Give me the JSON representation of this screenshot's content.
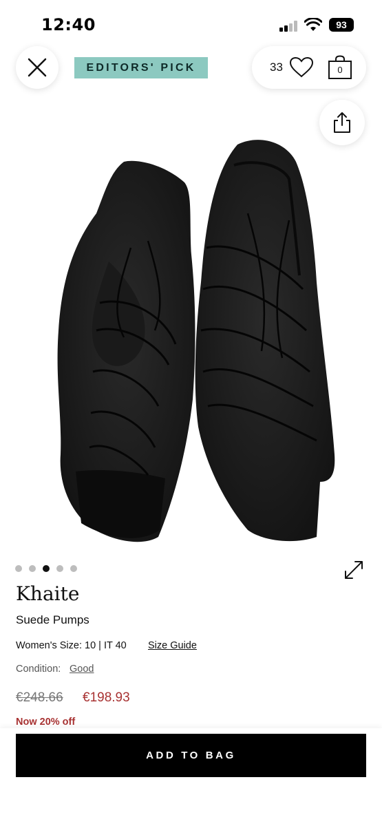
{
  "status": {
    "time": "12:40",
    "battery": "93"
  },
  "header": {
    "badge": "EDITORS' PICK",
    "like_count": "33",
    "bag_count": "0"
  },
  "carousel": {
    "total": 5,
    "active": 3
  },
  "product": {
    "brand": "Khaite",
    "name": "Suede Pumps",
    "size": "Women's Size: 10 | IT 40",
    "size_guide": "Size Guide",
    "condition_label": "Condition:",
    "condition_value": "Good",
    "price_old": "€248.66",
    "price_new": "€198.93",
    "discount": "Now 20% off"
  },
  "cta": {
    "add_to_bag": "ADD TO BAG"
  },
  "colors": {
    "badge": "#8cc9c0",
    "sale": "#a83232"
  },
  "icons": [
    "close-icon",
    "heart-icon",
    "bag-icon",
    "share-icon",
    "expand-icon"
  ]
}
